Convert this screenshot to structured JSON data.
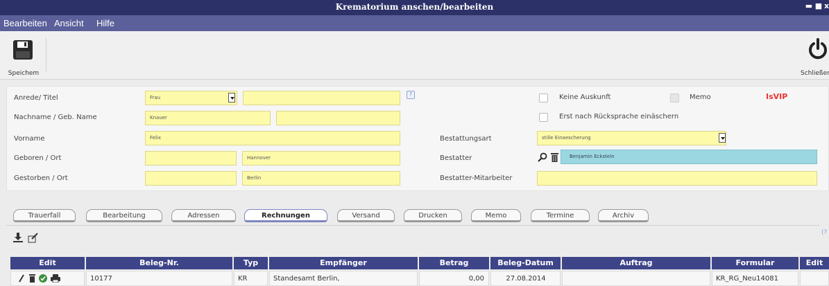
{
  "window": {
    "title": "Krematorium anschen/bearbeiten",
    "controls": {
      "minimize": "▬",
      "maximize": "■",
      "close": "x"
    }
  },
  "menu": {
    "items": [
      "Bearbeiten",
      "Ansicht",
      "Hilfe"
    ]
  },
  "toolbar": {
    "save_label": "Speichem",
    "close_label": "Schließen"
  },
  "form": {
    "anrede_label": "Anrede/ Titel",
    "anrede_value": "Frau",
    "titel_value": "",
    "help_glyph": "?",
    "nachname_label": "Nachname / Geb. Name",
    "nachname_value": "Knauer",
    "geburtsname_value": "",
    "vorname_label": "Vorname",
    "vorname_value": "Felix",
    "geboren_label": "Geboren / Ort",
    "geboren_datum": "",
    "geboren_ort": "Hannover",
    "gestorben_label": "Gestorben / Ort",
    "gestorben_datum": "",
    "gestorben_ort": "Berlin",
    "keine_auskunft_label": "Keine Auskunft",
    "memo_label": "Memo",
    "isvip_label": "IsVIP",
    "erst_nach_label": "Erst nach Rücksprache einäschern",
    "bestattungsart_label": "Bestattungsart",
    "bestattungsart_value": "stille Einaescherung",
    "bestatter_label": "Bestatter",
    "bestatter_value": "Benjamin Eckstein",
    "bestatter_mitarbeiter_label": "Bestatter-Mitarbeiter",
    "bestatter_mitarbeiter_value": ""
  },
  "tabs": [
    "Trauerfall",
    "Bearbeitung",
    "Adressen",
    "Rechnungen",
    "Versand",
    "Drucken",
    "Memo",
    "Termine",
    "Archiv"
  ],
  "active_tab": "Rechnungen",
  "side_help": "(?",
  "invoices": {
    "columns": [
      "Edit",
      "Beleg-Nr.",
      "Typ",
      "Empfänger",
      "Betrag",
      "Beleg-Datum",
      "Auftrag",
      "Formular",
      "Edit"
    ],
    "rows": [
      {
        "beleg_nr": "10177",
        "typ": "KR",
        "empfaenger": "Standesamt Berlin,",
        "betrag": "0,00",
        "beleg_datum": "27.08.2014",
        "auftrag": "",
        "formular": "KR_RG_Neu14081",
        "edit2": ""
      }
    ]
  },
  "colors": {
    "titlebar": "#2c3168",
    "menubar": "#5b609a",
    "field_yellow": "#fdfbaa",
    "field_cyan": "#9bd7e0",
    "grid_header": "#3d4488",
    "vip_red": "#e33333"
  }
}
